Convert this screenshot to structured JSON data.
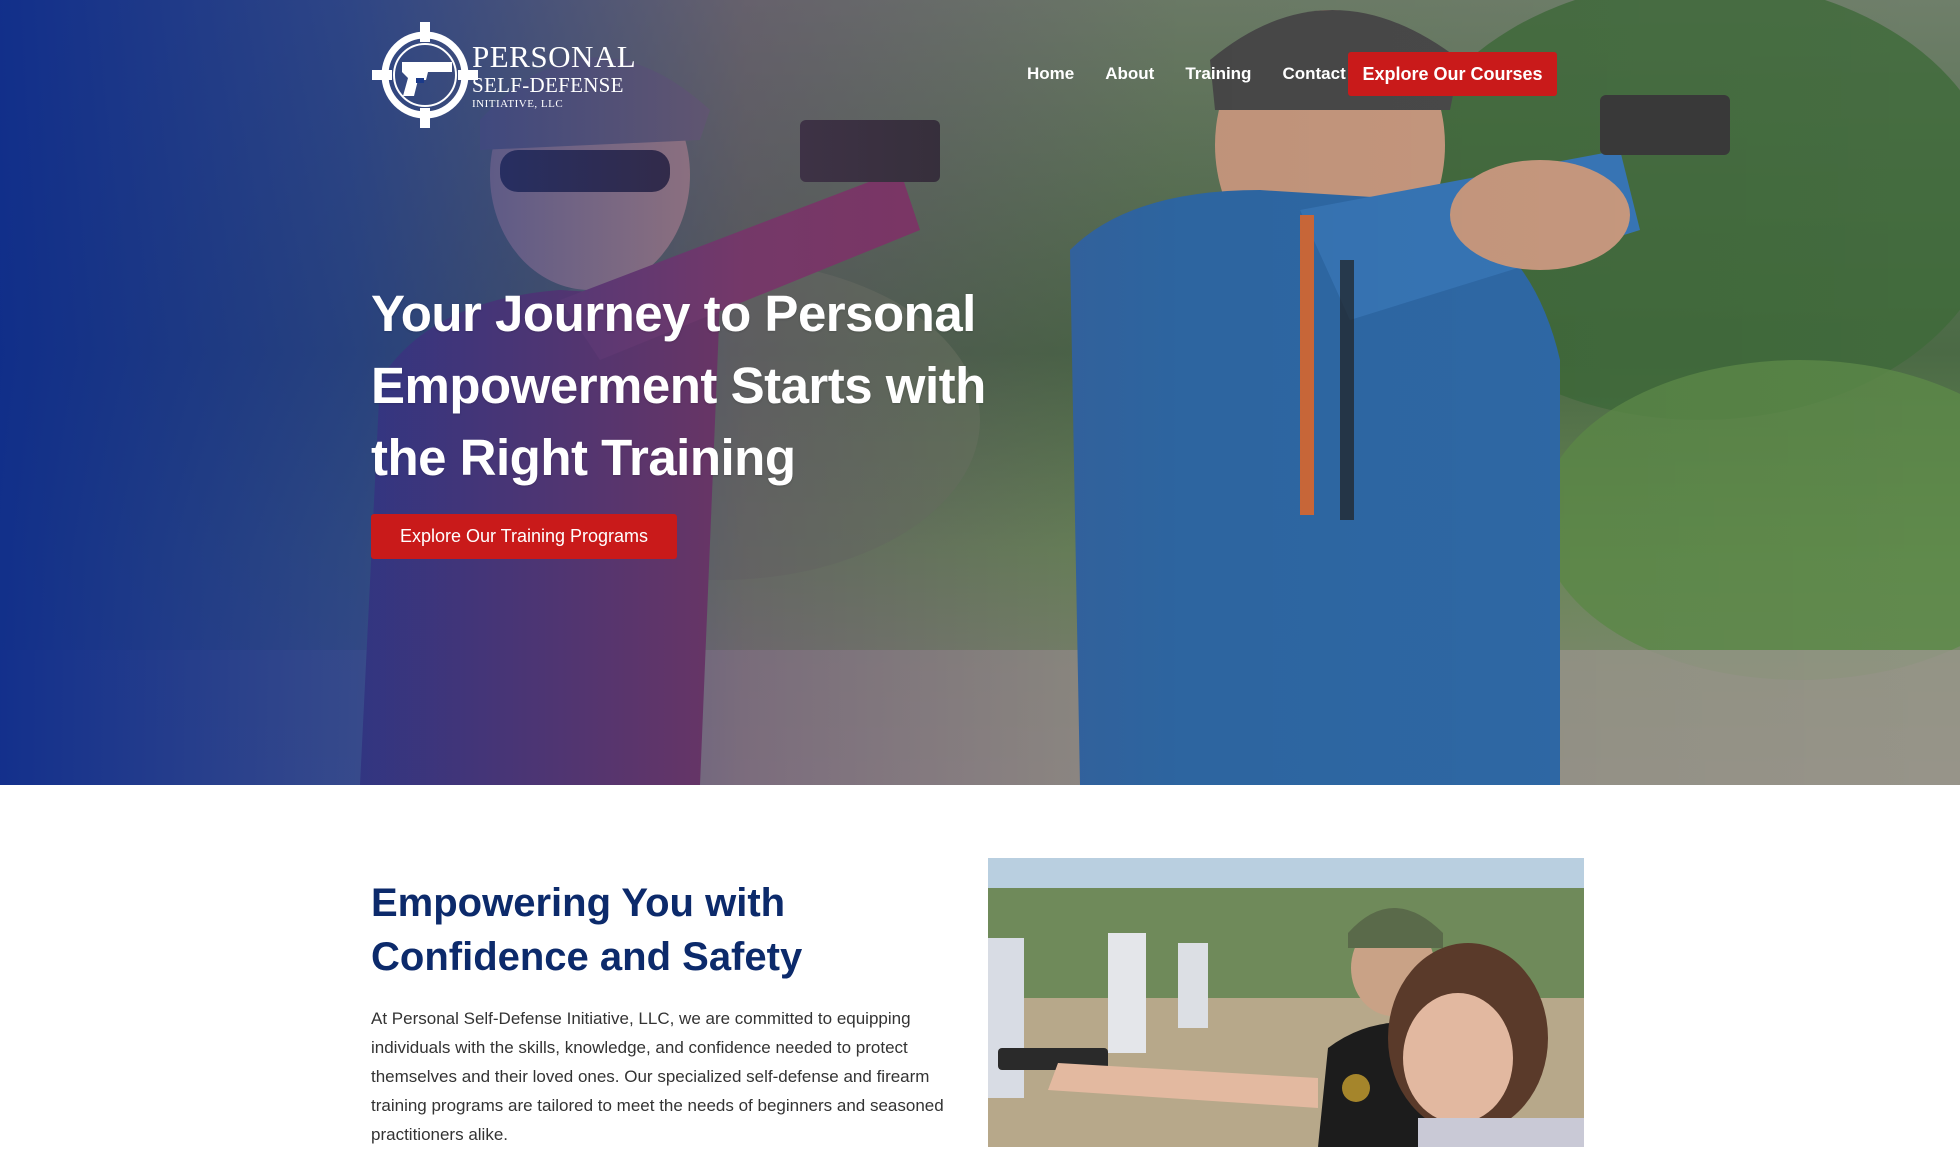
{
  "brand": {
    "line1": "PERSONAL",
    "line2": "SELF-DEFENSE",
    "line3": "INITIATIVE, LLC",
    "logo_icon": "crosshair-pistol-icon"
  },
  "nav": {
    "items": [
      "Home",
      "About",
      "Training",
      "Contact"
    ],
    "cta_label": "Explore Our Courses"
  },
  "hero": {
    "title": "Your Journey to Personal Empowerment Starts with the Right Training",
    "cta_label": "Explore Our Training Programs",
    "image": "two shooters aiming pistols at outdoor range"
  },
  "intro": {
    "heading": "Empowering You with Confidence and Safety",
    "body": "At Personal Self-Defense Initiative, LLC, we are committed to equipping individuals with the skills, knowledge, and confidence needed to protect themselves and their loved ones. Our specialized self-defense and firearm training programs are tailored to meet the needs of beginners and seasoned practitioners alike.",
    "image": "instructor coaching student aiming pistol at range targets"
  },
  "colors": {
    "accent_red": "#c91a1a",
    "heading_navy": "#0c2a6b",
    "hero_overlay_blue": "#0e2c8c"
  }
}
